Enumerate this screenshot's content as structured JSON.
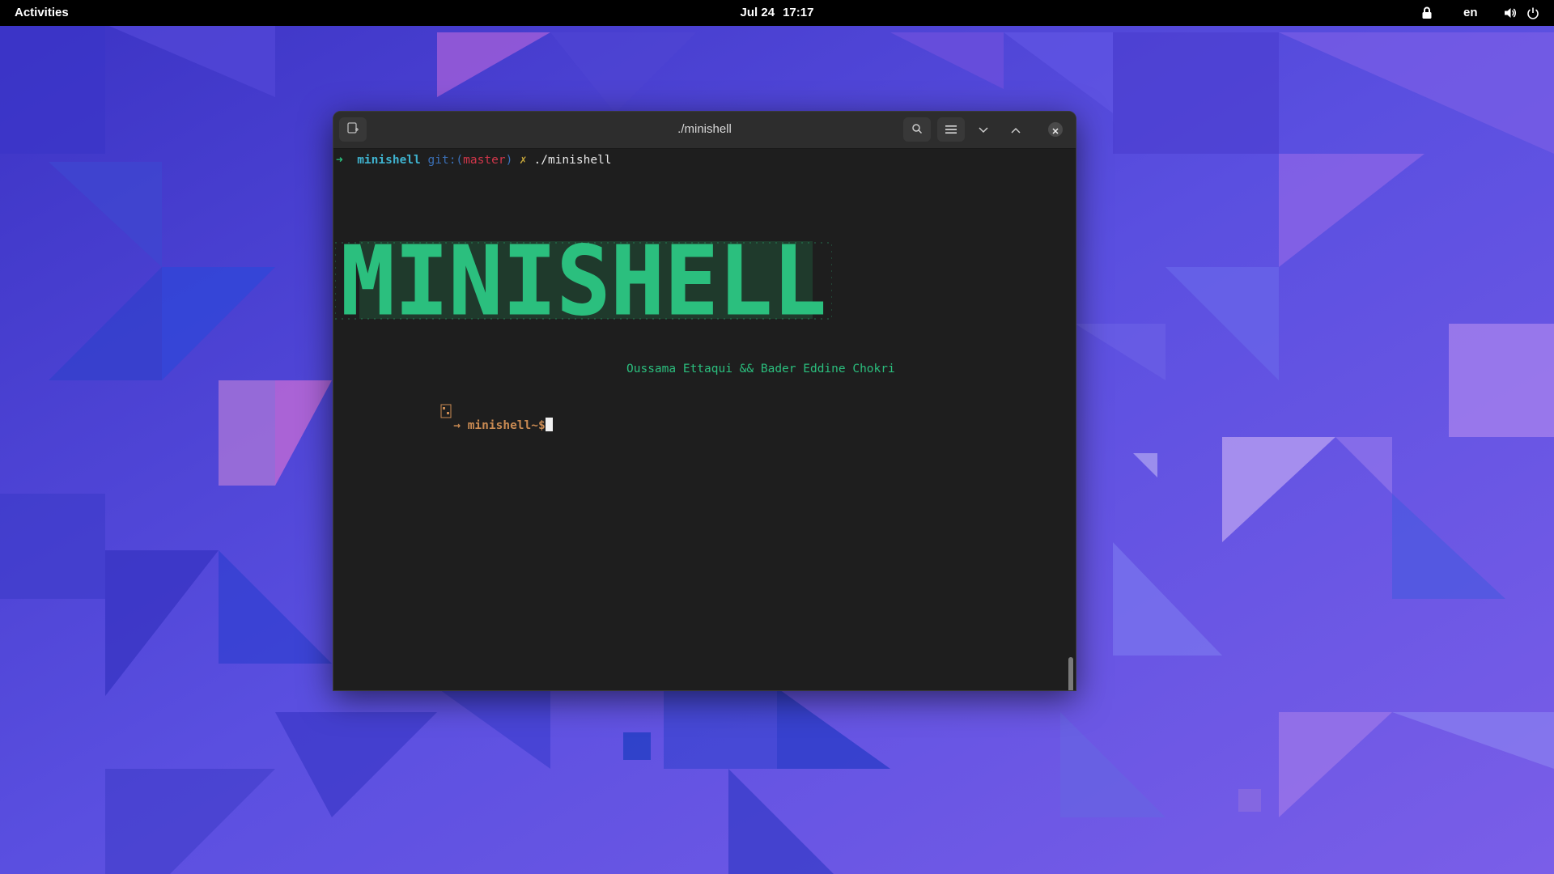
{
  "topbar": {
    "activities": "Activities",
    "date": "Jul 24",
    "time": "17:17",
    "language": "en",
    "icons": [
      "lock-icon",
      "volume-icon",
      "power-icon"
    ]
  },
  "terminal": {
    "title": "./minishell",
    "header_buttons": [
      "new-tab-icon",
      "search-icon",
      "menu-icon",
      "minimize-icon",
      "maximize-icon",
      "close-icon"
    ],
    "lines": {
      "cmd_arrow": "➜",
      "cmd_dir": "minishell",
      "cmd_git": "git:(",
      "cmd_branch": "master",
      "cmd_git_close": ")",
      "cmd_dirty": "✗",
      "cmd_text": "./minishell",
      "banner_text": "MINISHELL",
      "authors": "Oussama Ettaqui && Bader Eddine Chokri",
      "prompt": "→ minishell~$"
    },
    "colors": {
      "background": "#1e1e1e",
      "banner": "#2bbf7e",
      "prompt": "#c98a52",
      "dir": "#3fb3cf",
      "branch": "#d0364a"
    }
  }
}
